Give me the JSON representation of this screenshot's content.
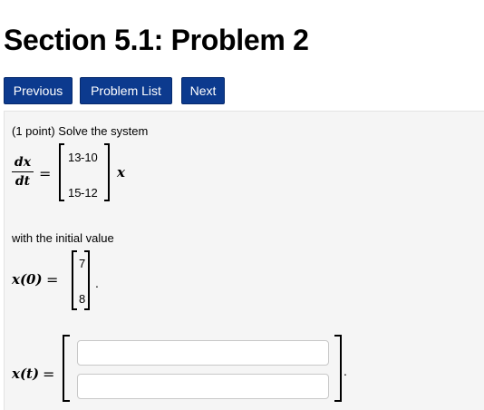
{
  "page": {
    "title": "Section 5.1: Problem 2"
  },
  "nav": {
    "previous": "Previous",
    "problem_list": "Problem List",
    "next": "Next"
  },
  "problem": {
    "intro": "(1 point) Solve the system",
    "lhs_numerator": "dx",
    "lhs_denominator": "dt",
    "equals": "=",
    "matrix": [
      [
        "13",
        "-10"
      ],
      [
        "15",
        "-12"
      ]
    ],
    "rhs_var": "x",
    "initial_text": "with the initial value",
    "x0_label": "x(0)",
    "x0_vector": [
      "7",
      "8"
    ],
    "period": ".",
    "xt_label": "x(t)",
    "answer_inputs": [
      {
        "value": "",
        "placeholder": ""
      },
      {
        "value": "",
        "placeholder": ""
      }
    ]
  }
}
